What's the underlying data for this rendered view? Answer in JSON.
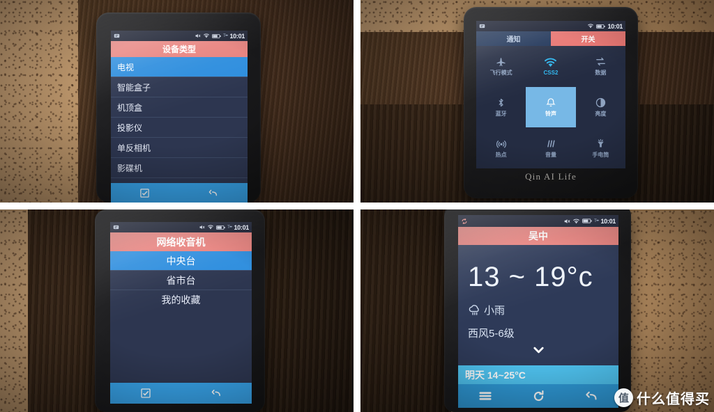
{
  "statusbar": {
    "sync_icon": "sync-icon",
    "mute_icon": "mute-icon",
    "wifi_icon": "wifi-icon",
    "battery_icon": "battery-icon",
    "signal_label": "T••",
    "time": "10:01"
  },
  "panel1": {
    "name": "device-type-list",
    "title": "设备类型",
    "items": [
      {
        "label": "电视",
        "selected": true
      },
      {
        "label": "智能盒子",
        "selected": false
      },
      {
        "label": "机顶盒",
        "selected": false
      },
      {
        "label": "投影仪",
        "selected": false
      },
      {
        "label": "单反相机",
        "selected": false
      },
      {
        "label": "影碟机",
        "selected": false
      }
    ],
    "bottom": {
      "confirm_icon": "checkbox-icon",
      "back_icon": "back-arrow-icon"
    }
  },
  "panel2": {
    "name": "quick-settings-toggles",
    "tabs": [
      {
        "label": "通知",
        "active": false
      },
      {
        "label": "开关",
        "active": true
      }
    ],
    "toggles": [
      {
        "label": "飞行模式",
        "icon": "airplane-icon",
        "state": "off"
      },
      {
        "label": "CSS2",
        "icon": "wifi-icon",
        "state": "wifi-on"
      },
      {
        "label": "数据",
        "icon": "data-sync-icon",
        "state": "off"
      },
      {
        "label": "蓝牙",
        "icon": "bluetooth-icon",
        "state": "off"
      },
      {
        "label": "铃声",
        "icon": "bell-icon",
        "state": "on"
      },
      {
        "label": "亮度",
        "icon": "brightness-icon",
        "state": "off"
      },
      {
        "label": "热点",
        "icon": "hotspot-icon",
        "state": "off"
      },
      {
        "label": "音量",
        "icon": "volume-icon",
        "state": "off"
      },
      {
        "label": "手电筒",
        "icon": "flashlight-icon",
        "state": "off"
      }
    ],
    "branding": "Qin AI Life"
  },
  "panel3": {
    "name": "network-radio-list",
    "title": "网络收音机",
    "items": [
      {
        "label": "中央台",
        "selected": true
      },
      {
        "label": "省市台",
        "selected": false
      },
      {
        "label": "我的收藏",
        "selected": false
      }
    ],
    "bottom": {
      "confirm_icon": "checkbox-icon",
      "back_icon": "back-arrow-icon"
    }
  },
  "panel4": {
    "name": "weather-screen",
    "title": "吴中",
    "temperature": "13 ~ 19°c",
    "condition": "小雨",
    "condition_icon": "cloud-rain-icon",
    "wind": "西风5-6级",
    "expand_icon": "chevron-down-icon",
    "tomorrow": "明天 14~25°C",
    "bar": {
      "menu_icon": "hamburger-menu-icon",
      "refresh_icon": "refresh-icon",
      "back_icon": "back-arrow-icon"
    }
  },
  "watermark": {
    "logo_char": "值",
    "text": "什么值得买"
  },
  "colors": {
    "title_red": "#e8827e",
    "selected_blue": "#2e8ede",
    "list_navy": "#2d3650",
    "accent_cyan": "#4fc3f0",
    "bar_blue": "#2f9ad8"
  }
}
